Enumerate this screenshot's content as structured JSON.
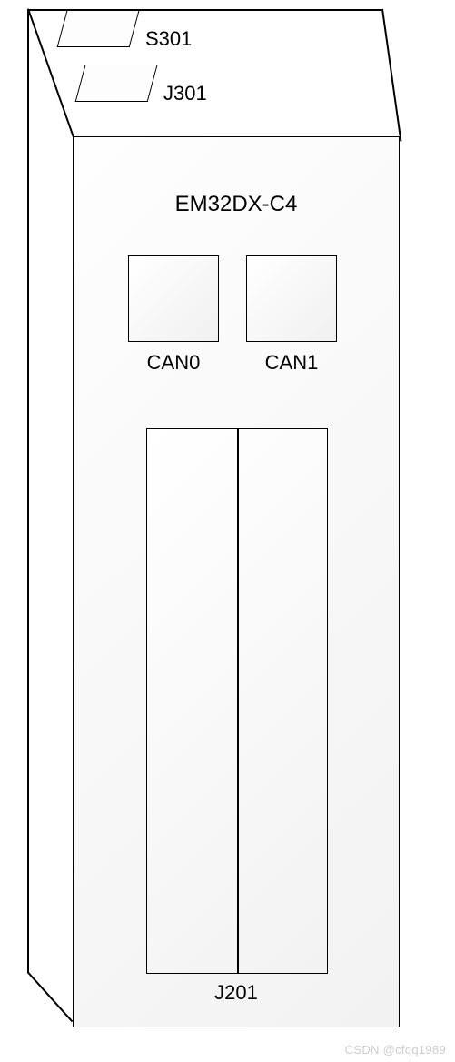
{
  "module": {
    "name": "EM32DX-C4"
  },
  "top_connectors": {
    "slot1": "S301",
    "slot2": "J301"
  },
  "can_ports": {
    "port0": "CAN0",
    "port1": "CAN1"
  },
  "main_connector": {
    "label": "J201"
  },
  "watermark": "CSDN @cfqq1989"
}
